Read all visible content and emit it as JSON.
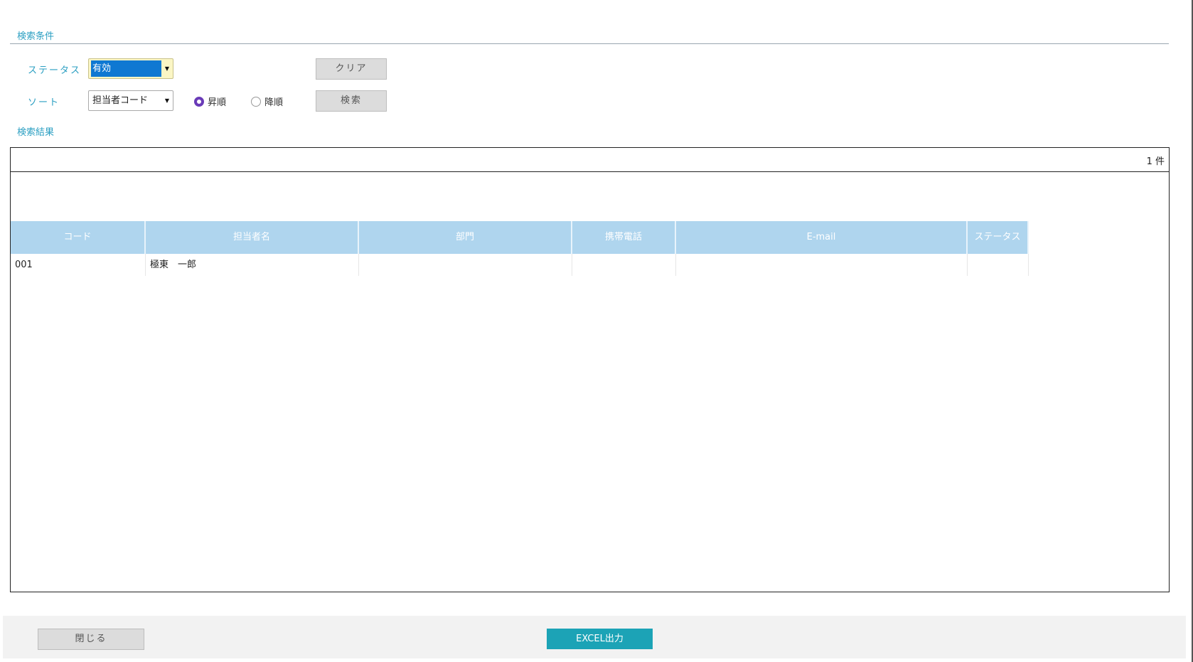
{
  "search_section": {
    "title": "検索条件"
  },
  "status_field": {
    "label": "ステータス",
    "value": "有効"
  },
  "sort_field": {
    "label": "ソート",
    "value": "担当者コード",
    "order_options": [
      {
        "label": "昇順",
        "selected": true
      },
      {
        "label": "降順",
        "selected": false
      }
    ]
  },
  "buttons": {
    "clear": "クリア",
    "search": "検索",
    "close": "閉じる",
    "excel": "EXCEL出力"
  },
  "results_section": {
    "title": "検索結果",
    "count_text": "1 件"
  },
  "table": {
    "headers": [
      "コード",
      "担当者名",
      "部門",
      "携帯電話",
      "E-mail",
      "ステータス"
    ],
    "rows": [
      [
        "001",
        "極東　一郎",
        "",
        "",
        "",
        ""
      ]
    ]
  },
  "colors": {
    "accent": "#2b9fc2",
    "header_bg": "#afd5ee",
    "excel_button": "#1ca3b6",
    "radio_selected": "#6a3bb8"
  }
}
